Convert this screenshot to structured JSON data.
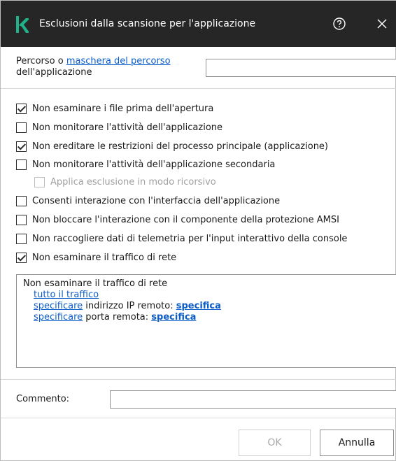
{
  "dialog": {
    "title": "Esclusioni dalla scansione per l'applicazione",
    "logo_glyph": "K",
    "brand_color": "#1eb38a"
  },
  "path": {
    "label_prefix": "Percorso o ",
    "label_link": "maschera del percorso",
    "label_suffix": "dell'applicazione",
    "value": ""
  },
  "options": [
    {
      "label": "Non esaminare i file prima dell'apertura",
      "checked": true,
      "disabled": false
    },
    {
      "label": "Non monitorare l'attività dell'applicazione",
      "checked": false,
      "disabled": false
    },
    {
      "label": "Non ereditare le restrizioni del processo principale (applicazione)",
      "checked": true,
      "disabled": false
    },
    {
      "label": "Non monitorare l'attività dell'applicazione secondaria",
      "checked": false,
      "disabled": false
    },
    {
      "label": "Applica esclusione in modo ricorsivo",
      "checked": false,
      "disabled": true
    },
    {
      "label": "Consenti interazione con l'interfaccia dell'applicazione",
      "checked": false,
      "disabled": false
    },
    {
      "label": "Non bloccare l'interazione con il componente della protezione AMSI",
      "checked": false,
      "disabled": false
    },
    {
      "label": "Non raccogliere dati di telemetria per l'input interattivo della console",
      "checked": false,
      "disabled": false
    },
    {
      "label": "Non esaminare il traffico di rete",
      "checked": true,
      "disabled": false
    }
  ],
  "network": {
    "heading": "Non esaminare il traffico di rete",
    "all_traffic_link": "tutto il traffico",
    "ip_specify_link": "specificare",
    "ip_text": " indirizzo IP remoto: ",
    "ip_value_link": "specifica",
    "port_specify_link": "specificare",
    "port_text": " porta remota: ",
    "port_value_link": "specifica"
  },
  "comment": {
    "label": "Commento:",
    "value": ""
  },
  "buttons": {
    "ok": "OK",
    "cancel": "Annulla"
  }
}
